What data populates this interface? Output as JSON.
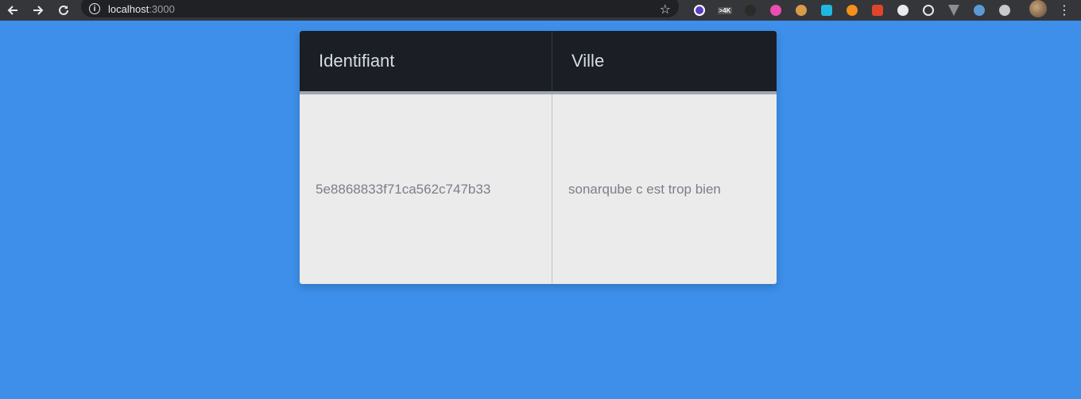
{
  "browser": {
    "url_host": "localhost",
    "url_port": ":3000",
    "extension_badge": ">4K"
  },
  "table": {
    "headers": [
      "Identifiant",
      "Ville"
    ],
    "rows": [
      [
        "5e8868833f71ca562c747b33",
        "sonarqube c est trop bien"
      ]
    ]
  },
  "colors": {
    "page_background": "#3d8fea",
    "header_background": "#1b1e24",
    "row_background": "#ebebeb"
  }
}
